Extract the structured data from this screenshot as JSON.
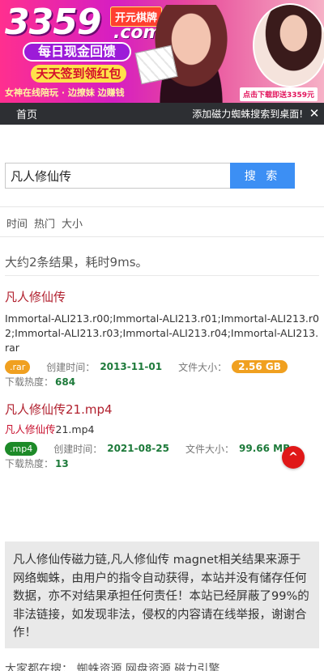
{
  "banner": {
    "brand": "3359",
    "tag": "开元棋牌",
    "dotcom": ".com",
    "pill1": "每日现金回馈",
    "pill2": "天天签到领红包",
    "strip": "女神在线陪玩 · 边撩妹 边赚钱",
    "download": "点击下载即送3359元"
  },
  "nav": {
    "home": "首页",
    "add_tip": "添加磁力蜘蛛搜索到桌面!",
    "close": "✕"
  },
  "search": {
    "value": "凡人修仙传",
    "button": "搜 索"
  },
  "sort_tabs": [
    "时间",
    "热门",
    "大小"
  ],
  "summary": "大约2条结果，耗时9ms。",
  "results": [
    {
      "title": "凡人修仙传",
      "files": "Immortal-ALI213.r00;Immortal-ALI213.r01;Immortal-ALI213.r02;Immortal-ALI213.r03;Immortal-ALI213.r04;Immortal-ALI213.rar",
      "ext": ".rar",
      "created_label": "创建时间：",
      "created": "2013-11-01",
      "size_label": "文件大小：",
      "size": "2.56 GB",
      "hot_label": "下载热度：",
      "hot": "684"
    },
    {
      "title": "凡人修仙传21.mp4",
      "file_highlight": "凡人修仙传",
      "file_rest": "21.mp4",
      "ext": ".mp4",
      "created_label": "创建时间：",
      "created": "2021-08-25",
      "size_label": "文件大小：",
      "size": "99.66 MB",
      "hot_label": "下载热度：",
      "hot": "13"
    }
  ],
  "back_to_top": "^",
  "disclaimer": "凡人修仙传磁力链,凡人修仙传 magnet相关结果来源于网络蜘蛛，由用户的指令自动获得，本站并没有储存任何数据，亦不对结果承担任何责任！本站已经屏蔽了99%的非法链接，如发现非法，侵权的内容请在线举报，谢谢合作！",
  "footer": "大家都在搜：   蜘蛛资源   网盘资源   磁力引擎"
}
